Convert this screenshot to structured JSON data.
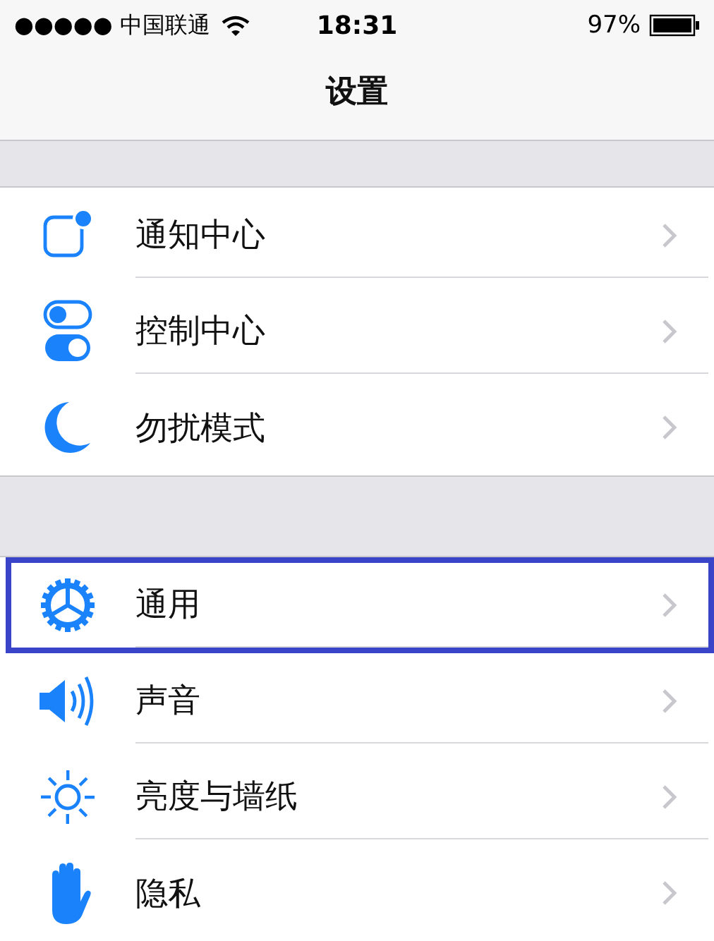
{
  "status_bar": {
    "carrier": "●●●●● 中国联通",
    "time": "18:31",
    "battery": "97%"
  },
  "nav": {
    "title": "设置"
  },
  "groups": [
    {
      "rows": [
        {
          "label": "通知中心",
          "selected": false
        },
        {
          "label": "控制中心",
          "selected": false
        },
        {
          "label": "勿扰模式",
          "selected": false
        }
      ]
    },
    {
      "rows": [
        {
          "label": "通用",
          "selected": true
        },
        {
          "label": "声音",
          "selected": false
        },
        {
          "label": "亮度与墙纸",
          "selected": false
        },
        {
          "label": "隐私",
          "selected": false
        }
      ]
    }
  ]
}
